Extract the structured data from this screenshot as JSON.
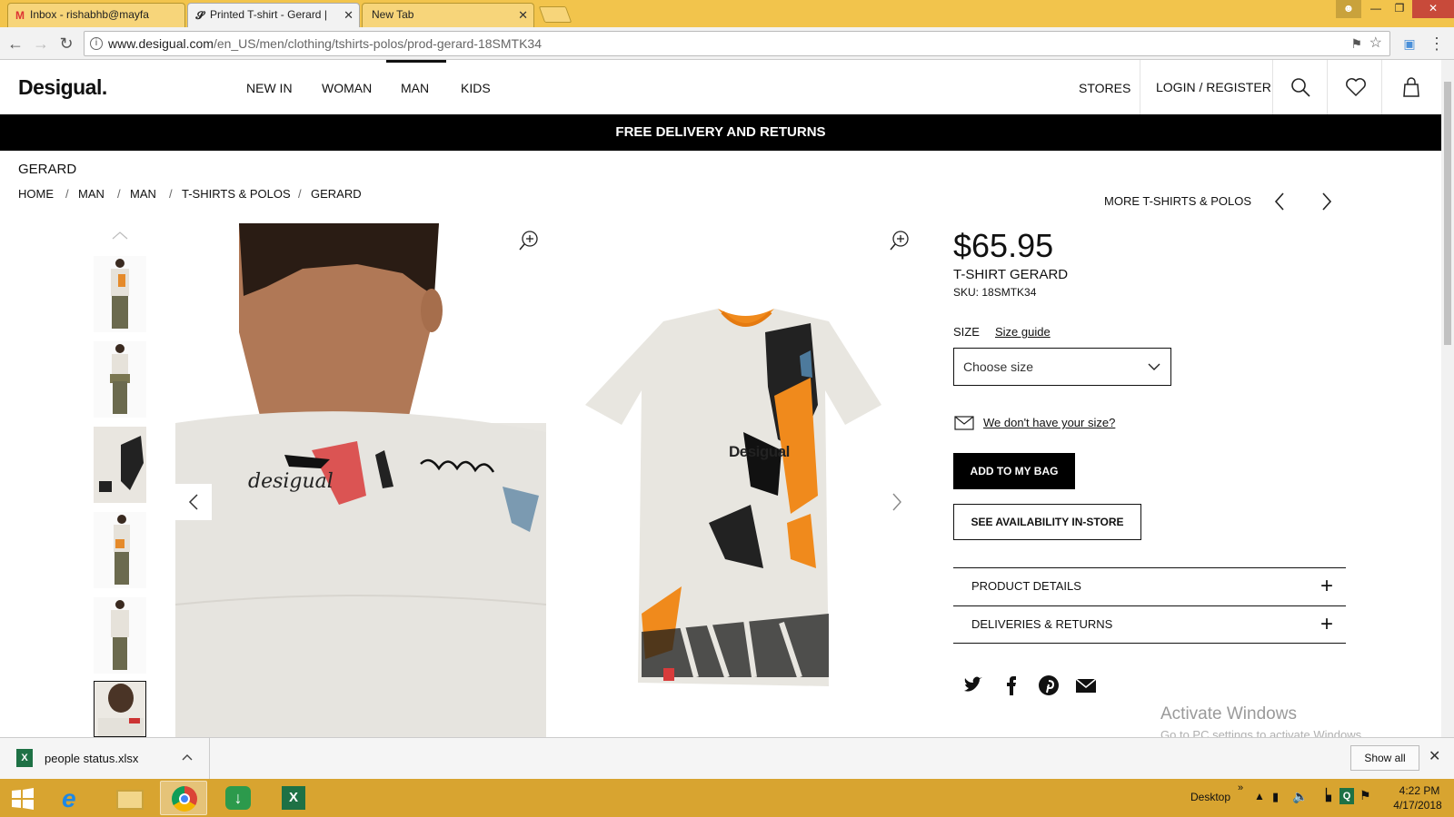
{
  "browser": {
    "tabs": [
      {
        "title": "Inbox - rishabhb@mayfa",
        "icon": "gmail-icon"
      },
      {
        "title": "Printed T-shirt - Gerard |",
        "icon": "desigual-icon"
      },
      {
        "title": "New Tab",
        "icon": ""
      }
    ],
    "url_domain": "www.desigual.com",
    "url_path": "/en_US/men/clothing/tshirts-polos/prod-gerard-18SMTK34"
  },
  "header": {
    "logo": "Desigual.",
    "nav": [
      "NEW IN",
      "WOMAN",
      "MAN",
      "KIDS"
    ],
    "stores": "STORES",
    "login": "LOGIN / REGISTER"
  },
  "promo": "FREE DELIVERY AND RETURNS",
  "page": {
    "title": "GERARD",
    "breadcrumb": [
      "HOME",
      "MAN",
      "MAN",
      "T-SHIRTS & POLOS",
      "GERARD"
    ],
    "more_link": "MORE T-SHIRTS & POLOS"
  },
  "product": {
    "price": "$65.95",
    "name": "T-SHIRT GERARD",
    "sku": "SKU: 18SMTK34",
    "size_label": "SIZE",
    "size_guide": "Size guide",
    "size_placeholder": "Choose size",
    "no_size": "We don't have your size?",
    "add_to_bag": "ADD TO MY BAG",
    "availability": "SEE AVAILABILITY IN-STORE",
    "accordion": [
      "PRODUCT DETAILS",
      "DELIVERIES & RETURNS"
    ],
    "tshirt_print_text": "Desigual",
    "back_print_text": "desigual"
  },
  "watermark": {
    "title": "Activate Windows",
    "subtitle": "Go to PC settings to activate Windows."
  },
  "downloads": {
    "file": "people status.xlsx",
    "show_all": "Show all"
  },
  "taskbar": {
    "desktop": "Desktop",
    "time": "4:22 PM",
    "date": "4/17/2018"
  },
  "colors": {
    "tab_bar": "#f2c44c",
    "taskbar": "#d8a430",
    "promo_bg": "#000000",
    "accent_orange": "#f08a1c"
  }
}
